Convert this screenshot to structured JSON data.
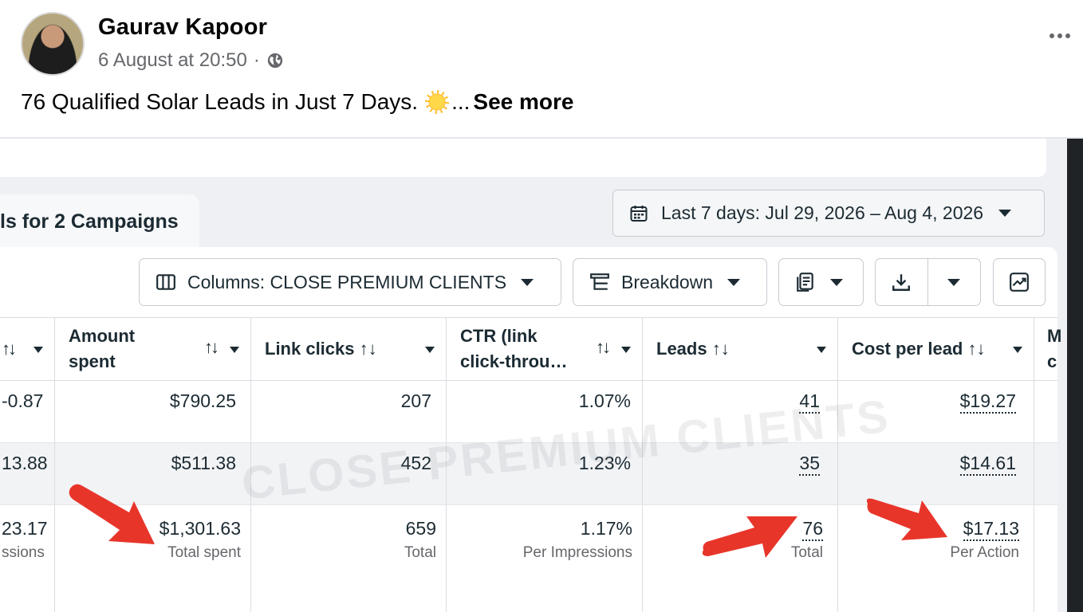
{
  "post": {
    "author": "Gaurav Kapoor",
    "timestamp": "6 August at 20:50",
    "separator": "·",
    "text": "76 Qualified Solar Leads in Just 7 Days.",
    "ellipsis": "...",
    "see_more": "See more"
  },
  "ads_manager": {
    "campaign_tab": "ls for 2 Campaigns",
    "date_range": "Last 7 days: Jul 29, 2026 – Aug 4, 2026",
    "toolbar": {
      "columns_label": "Columns: CLOSE PREMIUM CLIENTS",
      "breakdown_label": "Breakdown"
    },
    "watermark": "CLOSE PREMIUM CLIENTS",
    "table": {
      "headers": {
        "prev": "↑↓",
        "amount_spent_1": "Amount",
        "amount_spent_2": "spent",
        "link_clicks": "Link clicks ↑↓",
        "ctr_1": "CTR (link",
        "ctr_2": "click-throu…",
        "leads": "Leads ↑↓",
        "cost_per_lead": "Cost per lead ↑↓",
        "next_1": "M",
        "next_2": "c"
      },
      "rows": [
        {
          "prev": "-0.87",
          "amount_spent": "$790.25",
          "link_clicks": "207",
          "ctr": "1.07%",
          "leads": "41",
          "cost_per_lead": "$19.27"
        },
        {
          "prev": "13.88",
          "amount_spent": "$511.38",
          "link_clicks": "452",
          "ctr": "1.23%",
          "leads": "35",
          "cost_per_lead": "$14.61"
        }
      ],
      "totals": {
        "prev": "23.17",
        "prev_sub": "ssions",
        "amount_spent": "$1,301.63",
        "amount_spent_sub": "Total spent",
        "link_clicks": "659",
        "link_clicks_sub": "Total",
        "ctr": "1.17%",
        "ctr_sub": "Per Impressions",
        "leads": "76",
        "leads_sub": "Total",
        "cost_per_lead": "$17.13",
        "cost_per_lead_sub": "Per Action"
      }
    }
  },
  "colors": {
    "arrow": "#e8352a",
    "link_dark": "#1c2b33",
    "muted": "#65676b"
  }
}
